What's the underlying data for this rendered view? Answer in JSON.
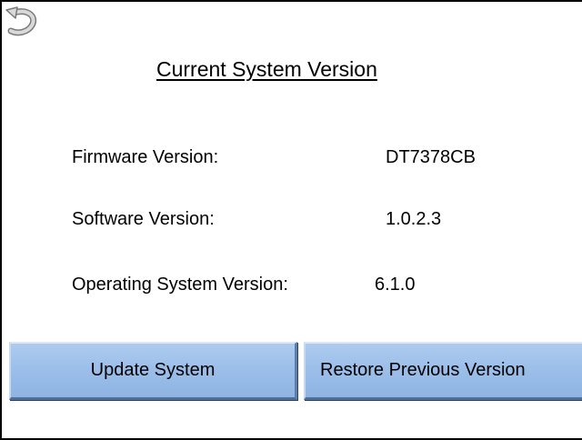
{
  "header": {
    "title": "Current System Version",
    "back_icon": "back-arrow-icon"
  },
  "info": [
    {
      "label": "Firmware Version:",
      "value": "DT7378CB"
    },
    {
      "label": "Software Version:",
      "value": "1.0.2.3"
    },
    {
      "label": "Operating System Version:",
      "value": "6.1.0"
    }
  ],
  "actions": {
    "update_label": "Update System",
    "restore_label": "Restore Previous Version"
  },
  "colors": {
    "button_fill": "#9cbfea",
    "button_border_dark": "#4f6f99",
    "border": "#000000",
    "background": "#ffffff"
  }
}
